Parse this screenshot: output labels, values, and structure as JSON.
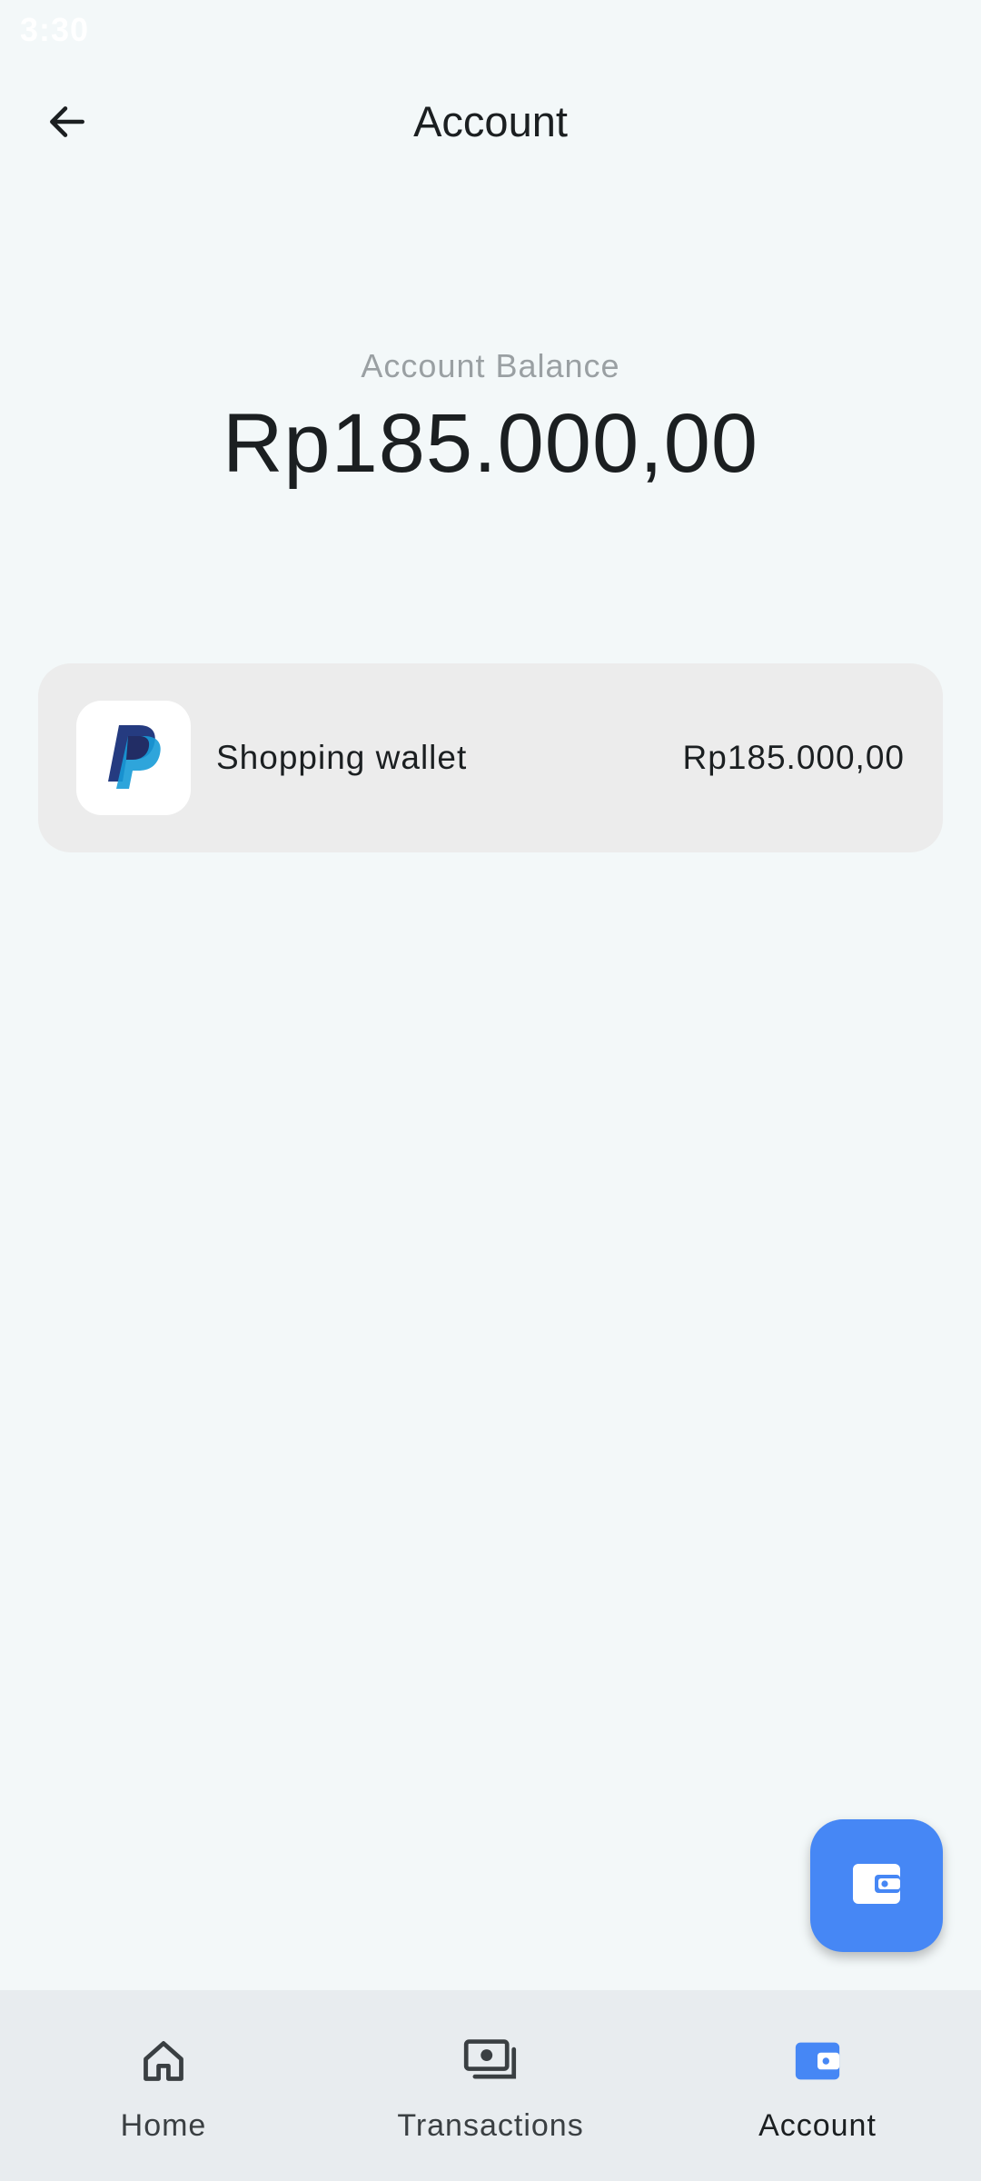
{
  "status_bar": {
    "time": "3:30"
  },
  "header": {
    "title": "Account",
    "back_icon": "arrow-left-icon"
  },
  "balance": {
    "label": "Account Balance",
    "amount": "Rp185.000,00"
  },
  "wallets": [
    {
      "name": "Shopping wallet",
      "amount": "Rp185.000,00",
      "icon": "paypal-logo-icon"
    }
  ],
  "fab": {
    "icon": "wallet-icon"
  },
  "bottom_nav": {
    "items": [
      {
        "label": "Home",
        "icon": "home-icon",
        "active": false
      },
      {
        "label": "Transactions",
        "icon": "cash-icon",
        "active": false
      },
      {
        "label": "Account",
        "icon": "wallet-icon",
        "active": true
      }
    ]
  },
  "colors": {
    "background": "#f3f8f9",
    "accent": "#4687f5",
    "card": "#ececec",
    "nav_background": "#e8ecef",
    "muted_text": "#9aa0a3",
    "text": "#1b1f21"
  }
}
